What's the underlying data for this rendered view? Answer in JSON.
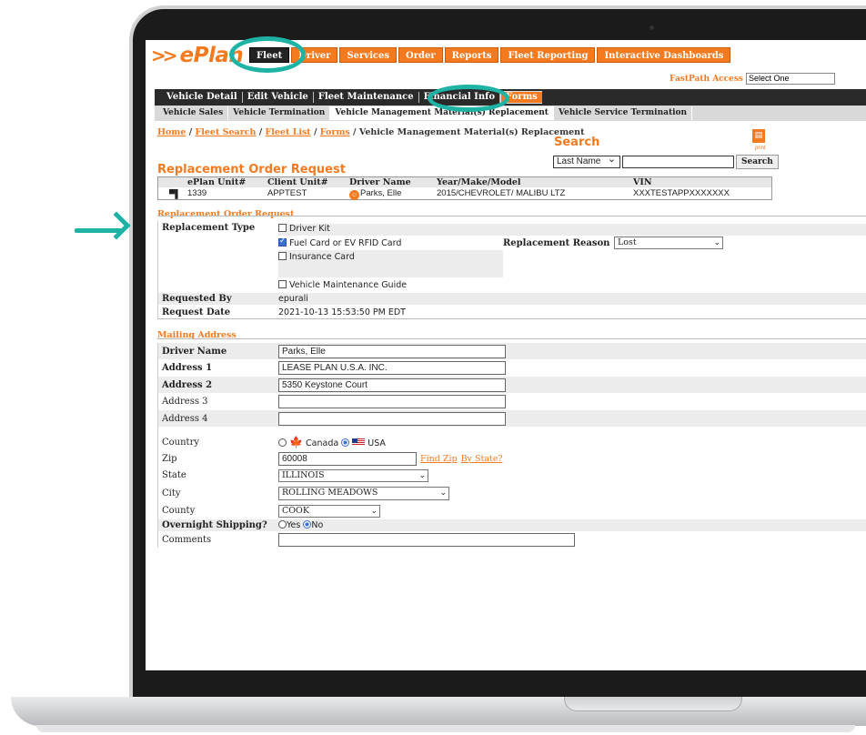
{
  "header": {
    "logo_prefix": ">>",
    "logo_text": "ePlan",
    "nav": [
      {
        "label": "Fleet",
        "active": true
      },
      {
        "label": "Driver",
        "active": false
      },
      {
        "label": "Services",
        "active": false
      },
      {
        "label": "Order",
        "active": false
      },
      {
        "label": "Reports",
        "active": false
      },
      {
        "label": "Fleet Reporting",
        "active": false
      },
      {
        "label": "Interactive Dashboards",
        "active": false
      }
    ],
    "fastpath_label": "FastPath Access",
    "fastpath_value": "Select One"
  },
  "subnav1": [
    "Vehicle Detail",
    "Edit Vehicle",
    "Fleet Maintenance",
    "Financial Info",
    "Forms"
  ],
  "subnav1_active": "Forms",
  "subnav2": [
    "Vehicle Sales",
    "Vehicle Termination",
    "Vehicle Management Material(s) Replacement",
    "Vehicle Service Termination"
  ],
  "subnav2_active": "Vehicle Management Material(s) Replacement",
  "breadcrumb": {
    "links": [
      "Home",
      "Fleet Search",
      "Fleet List",
      "Forms"
    ],
    "current": "Vehicle Management Material(s) Replacement"
  },
  "search": {
    "title": "Search",
    "field_value": "Last Name",
    "button": "Search",
    "print_label": "print"
  },
  "vehicle": {
    "section_title": "Replacement Order Request",
    "headers": [
      "ePlan Unit#",
      "Client Unit#",
      "Driver Name",
      "Year/Make/Model",
      "VIN"
    ],
    "row": [
      "1339",
      "APPTEST",
      "Parks, Elle",
      "2015/CHEVROLET/ MALIBU LTZ",
      "XXXTESTAPPXXXXXXX"
    ]
  },
  "request": {
    "section_title": "Replacement Order Request",
    "type_label": "Replacement Type",
    "options": [
      {
        "label": "Driver Kit",
        "checked": false
      },
      {
        "label": "Fuel Card or EV RFID Card",
        "checked": true
      },
      {
        "label": "Insurance Card",
        "checked": false
      },
      {
        "label": "Vehicle Maintenance Guide",
        "checked": false
      }
    ],
    "reason_label": "Replacement Reason",
    "reason_value": "Lost",
    "requested_by_label": "Requested By",
    "requested_by": "epurali",
    "request_date_label": "Request Date",
    "request_date": "2021-10-13 15:53:50 PM EDT"
  },
  "mailing": {
    "section_title": "Mailing Address",
    "driver_name_label": "Driver Name",
    "driver_name": "Parks, Elle",
    "address1_label": "Address 1",
    "address1": "LEASE PLAN U.S.A. INC.",
    "address2_label": "Address 2",
    "address2": "5350 Keystone Court",
    "address3_label": "Address 3",
    "address3": "",
    "address4_label": "Address 4",
    "address4": "",
    "country_label": "Country",
    "country_canada": "Canada",
    "country_usa": "USA",
    "country_selected": "USA",
    "zip_label": "Zip",
    "zip": "60008",
    "find_zip": "Find Zip",
    "by_state": "By State?",
    "state_label": "State",
    "state": "ILLINOIS",
    "city_label": "City",
    "city": "ROLLING MEADOWS",
    "county_label": "County",
    "county": "COOK",
    "overnight_label": "Overnight Shipping?",
    "overnight_yes": "Yes",
    "overnight_no": "No",
    "overnight_selected": "No",
    "comments_label": "Comments",
    "comments": ""
  },
  "colors": {
    "brand_orange": "#f47a20",
    "annotation_teal": "#1fb3a6",
    "nav_dark": "#2a2a2a"
  }
}
